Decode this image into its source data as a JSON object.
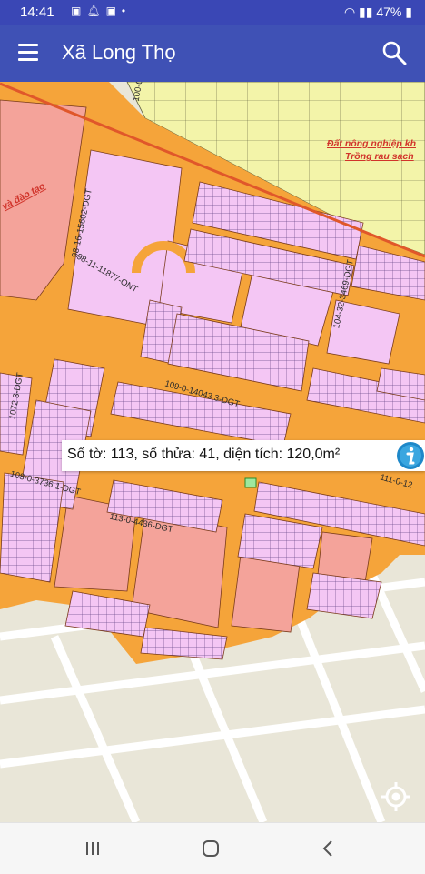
{
  "status_bar": {
    "time": "14:41",
    "icons": [
      "zalo-icon",
      "bell-icon",
      "zalo-icon",
      "dot-icon"
    ],
    "battery": "47%"
  },
  "app_bar": {
    "title": "Xã Long Thọ",
    "menu_icon": "hamburger-menu-icon",
    "search_icon": "search-icon"
  },
  "map": {
    "labels": {
      "road_100": "100-0",
      "road_98_16": "98-16-15602-DGT",
      "road_98_11": "98-11-11877-ONT",
      "zone_education": "và đào tạo",
      "zone_agri_line1": "Đất nông nghiệp kh",
      "zone_agri_line2": "Trồng rau sạch",
      "road_104": "104-32-3469-DGT",
      "road_109": "109-0-14043 3-DGT",
      "road_1072": "1072 3-DGT",
      "road_108": "108-0-3736 1-DGT",
      "road_113": "113-0-4436-DGT",
      "road_111": "111-0-12"
    },
    "colors": {
      "road": "#f5a43a",
      "residential": "#f4c6f4",
      "public": "#f4a39a",
      "agriculture": "#f3f4a9",
      "background": "#e9e6d8",
      "zone_label": "#d1342b"
    }
  },
  "popup": {
    "text": "Số tờ: 113, số thửa: 41, diện tích: 120,0m²",
    "info_icon": "info-icon"
  },
  "locate_button": "my-location-icon",
  "nav_bar": {
    "recents": "recents-icon",
    "home": "home-icon",
    "back": "back-icon"
  }
}
